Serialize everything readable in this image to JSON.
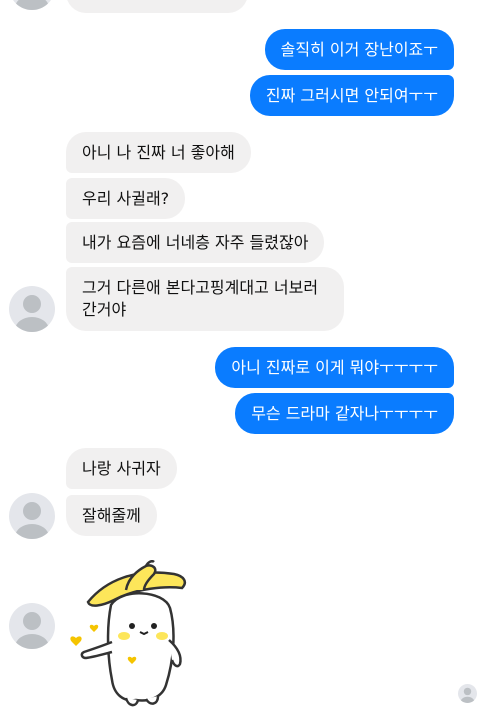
{
  "messages": {
    "out_1": "솔직히 이거 장난이죠ㅜ",
    "out_2": "진짜 그러시면 안되여ㅜㅜ",
    "in_1": "아니 나 진짜 너 좋아해",
    "in_2": "우리 사귈래?",
    "in_3": "내가 요즘에 너네층 자주 들렸잖아",
    "in_4_line1": "그거 다른애 본다고핑계대고 너보러",
    "in_4_line2": "간거야",
    "out_3": "아니 진짜로 이게 뭐야ㅜㅜㅜㅜ",
    "out_4": "무슨 드라마 같자나ㅜㅜㅜㅜ",
    "in_5": "나랑 사귀자",
    "in_6": "잘해줄께"
  },
  "colors": {
    "outgoing_bubble": "#0a7cff",
    "incoming_bubble": "#f1f0f0",
    "avatar_placeholder": "#e4e6eb"
  },
  "icons": {
    "avatar": "default-profile-avatar",
    "sticker": "banana-hat-ghost-sticker",
    "read_receipt": "seen-avatar-icon"
  }
}
